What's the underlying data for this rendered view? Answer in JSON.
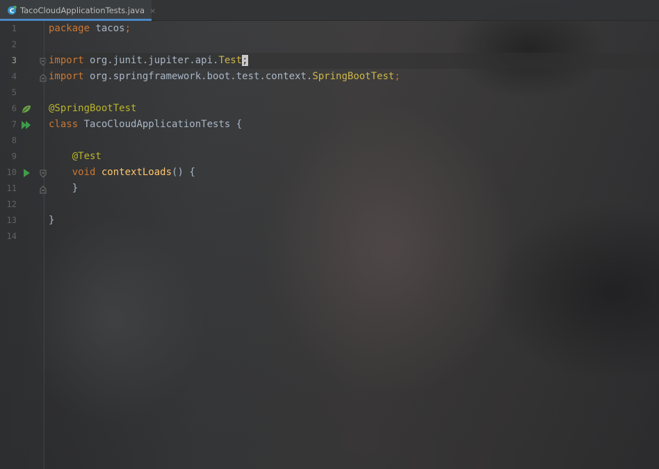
{
  "tab": {
    "title": "TacoCloudApplicationTests.java",
    "close_glyph": "×",
    "icon": "java-class-icon"
  },
  "colors": {
    "keyword": "#cc7832",
    "annotation": "#bbb529",
    "type": "#cdb74a",
    "method": "#ffc66d",
    "plain": "#a9b7c6",
    "tab_underline": "#4a88c7",
    "run_green": "#3f9c4b"
  },
  "gutter": {
    "line_numbers": [
      "1",
      "2",
      "3",
      "4",
      "5",
      "6",
      "7",
      "8",
      "9",
      "10",
      "11",
      "12",
      "13",
      "14"
    ],
    "current_line": "3",
    "icons": {
      "line6": "spring-bean-icon",
      "line7": "run-all-tests-icon",
      "line10": "run-test-icon"
    }
  },
  "code": {
    "line1": {
      "kw": "package",
      "rest": " tacos",
      "semi": ";"
    },
    "line3": {
      "kw": "import",
      "pkg": " org.junit.jupiter.api.",
      "type": "Test",
      "semi": ";"
    },
    "line4": {
      "kw": "import",
      "pkg": " org.springframework.boot.test.context.",
      "type": "SpringBootTest",
      "semi": ";"
    },
    "line6": {
      "ann": "@SpringBootTest"
    },
    "line7": {
      "kw": "class",
      "name": " TacoCloudApplicationTests",
      "brace": " {"
    },
    "line9": {
      "indent": "    ",
      "ann": "@Test"
    },
    "line10": {
      "indent": "    ",
      "kw": "void",
      "space": " ",
      "method": "contextLoads",
      "rest": "() {"
    },
    "line11": {
      "text": "    }"
    },
    "line13": {
      "text": "}"
    }
  }
}
